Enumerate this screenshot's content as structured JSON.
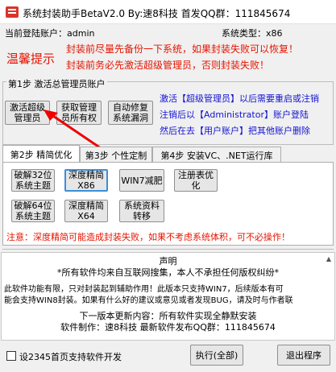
{
  "window": {
    "title": "系统封装助手BetaV2.0  By:速8科技  首发QQ群：111845674"
  },
  "header": {
    "current_user_label": "当前登陆账户：admin",
    "system_type_label": "系统类型：x86"
  },
  "tips": {
    "label": "温馨提示",
    "line1": "封装前尽量先备份一下系统，如果封装失败可以恢复！",
    "line2": "封装前务必先激活超级管理员，否则封装失败！"
  },
  "step1": {
    "title": "第1步 激活总管理员账户",
    "buttons": {
      "activate_admin": [
        "激活超级",
        "管理员"
      ],
      "take_ownership": [
        "获取管理",
        "员所有权"
      ],
      "auto_repair": [
        "自动修复",
        "系统漏洞"
      ]
    },
    "info_line1": "激活【超级管理员】以后需要重启或注销",
    "info_line2": "注销后以【Administrator】账户登陆",
    "info_line3": "然后在去【用户账户】把其他账户删除"
  },
  "tabs": [
    "第2步 精简优化",
    "第3步 个性定制",
    "第4步 安装VC、.NET运行库"
  ],
  "step2": {
    "buttons": {
      "crack32": [
        "破解32位",
        "系统主题"
      ],
      "deep_x86": [
        "深度精简",
        "X86"
      ],
      "win7_slim": [
        "WIN7减肥"
      ],
      "registry_opt": [
        "注册表优",
        "化"
      ],
      "crack64": [
        "破解64位",
        "系统主题"
      ],
      "deep_x64": [
        "深度精简",
        "X64"
      ],
      "sys_migrate": [
        "系统资料",
        "转移"
      ]
    },
    "warning": "注意：深度精简可能造成封装失败，如果不考虑系统体积，可不必操作！"
  },
  "statement": {
    "title": "声明",
    "line1": "*所有软件均来自互联网搜集，本人不承担任何版权纠纷*",
    "line2": "此软件功能有限，只对封装起到辅助作用！此版本只支持WIN7，后续版本有可",
    "line3": "能会支持WIN8封装。如果有什么好的建议或意见或者发现BUG，请及时与作者联",
    "line4": "下一版本更新内容：所有软件实现全静默安装",
    "line5": "软件制作：速8科技      最新软件发布QQ群：111845674"
  },
  "footer": {
    "checkbox_label": "设2345首页支持软件开发",
    "execute_label": "执行(全部)",
    "exit_label": "退出程序"
  }
}
